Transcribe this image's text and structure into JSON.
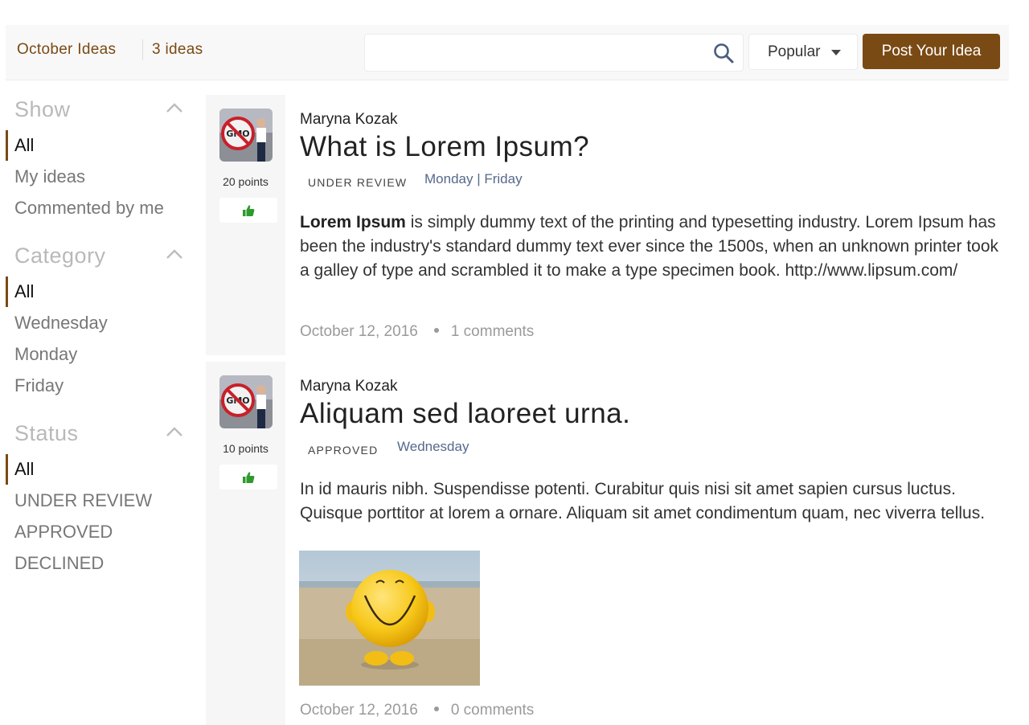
{
  "header": {
    "title": "October Ideas",
    "count": "3 ideas",
    "search_placeholder": "",
    "sort_selected": "Popular",
    "post_button": "Post Your Idea"
  },
  "sidebar": {
    "show": {
      "heading": "Show",
      "items": [
        "All",
        "My ideas",
        "Commented by me"
      ],
      "active": "All"
    },
    "category": {
      "heading": "Category",
      "items": [
        "All",
        "Wednesday",
        "Monday",
        "Friday"
      ],
      "active": "All"
    },
    "status": {
      "heading": "Status",
      "items": [
        "All",
        "UNDER REVIEW",
        "APPROVED",
        "DECLINED"
      ],
      "active": "All"
    }
  },
  "ideas": [
    {
      "author": "Maryna Kozak",
      "title": "What is Lorem Ipsum?",
      "status": "UNDER REVIEW",
      "categories": "Monday | Friday",
      "points": "20 points",
      "body_bold": "Lorem Ipsum",
      "body_rest": " is simply dummy text of the printing and typesetting industry. Lorem Ipsum has been the industry's standard dummy text ever since the 1500s, when an unknown printer took a galley of type and scrambled it to make a type specimen book. http://www.lipsum.com/",
      "date": "October 12, 2016",
      "comments": "1 comments"
    },
    {
      "author": "Maryna Kozak",
      "title": "Aliquam sed laoreet urna.",
      "status": "APPROVED",
      "categories": "Wednesday",
      "points": "10 points",
      "body": "In id mauris nibh. Suspendisse potenti. Curabitur quis nisi sit amet sapien cursus luctus. Quisque porttitor at lorem a ornare. Aliquam sit amet condimentum quam, nec viverra tellus.",
      "date": "October 12, 2016",
      "comments": "0 comments"
    }
  ],
  "colors": {
    "accent": "#7a4a14",
    "category_link": "#56698c",
    "vote_icon": "#2e9a2e"
  },
  "icons": {
    "search": "search-icon",
    "sort_caret": "caret-down-icon",
    "collapse": "chevron-up-icon",
    "vote": "thumbs-up-icon"
  }
}
